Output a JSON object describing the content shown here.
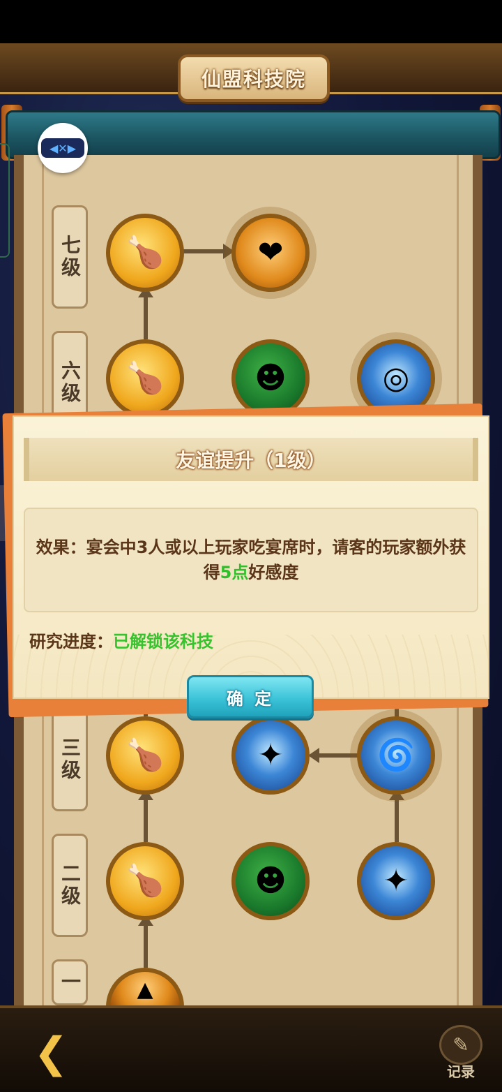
{
  "header": {
    "title": "仙盟科技院"
  },
  "levels": [
    {
      "label": "七级"
    },
    {
      "label": "六级"
    },
    {
      "label": "三级"
    },
    {
      "label": "二级"
    },
    {
      "label": "一"
    }
  ],
  "nodes": {
    "icons": {
      "feast": "roast-chicken-icon",
      "friend": "heart-figure-icon",
      "green": "green-crowd-icon",
      "blue": "blue-whirl-icon",
      "discount": "discount-tag-icon"
    }
  },
  "overlay_button": {
    "label": "◀✕▶"
  },
  "popup": {
    "title": "友谊提升（1级）",
    "effect_prefix": "效果：宴会中3人或以上玩家吃宴席时，请客的玩家额外获得",
    "effect_highlight": "5点",
    "effect_suffix": "好感度",
    "progress_label": "研究进度：",
    "progress_value": "已解锁该科技",
    "confirm": "确 定"
  },
  "bottom": {
    "record_label": "记录",
    "back_icon": "back-arrow-icon",
    "record_icon": "notepad-pen-icon"
  },
  "colors": {
    "highlight": "#2fbf2a",
    "button": "#3cc3d8",
    "parchment": "#ddc79e"
  }
}
